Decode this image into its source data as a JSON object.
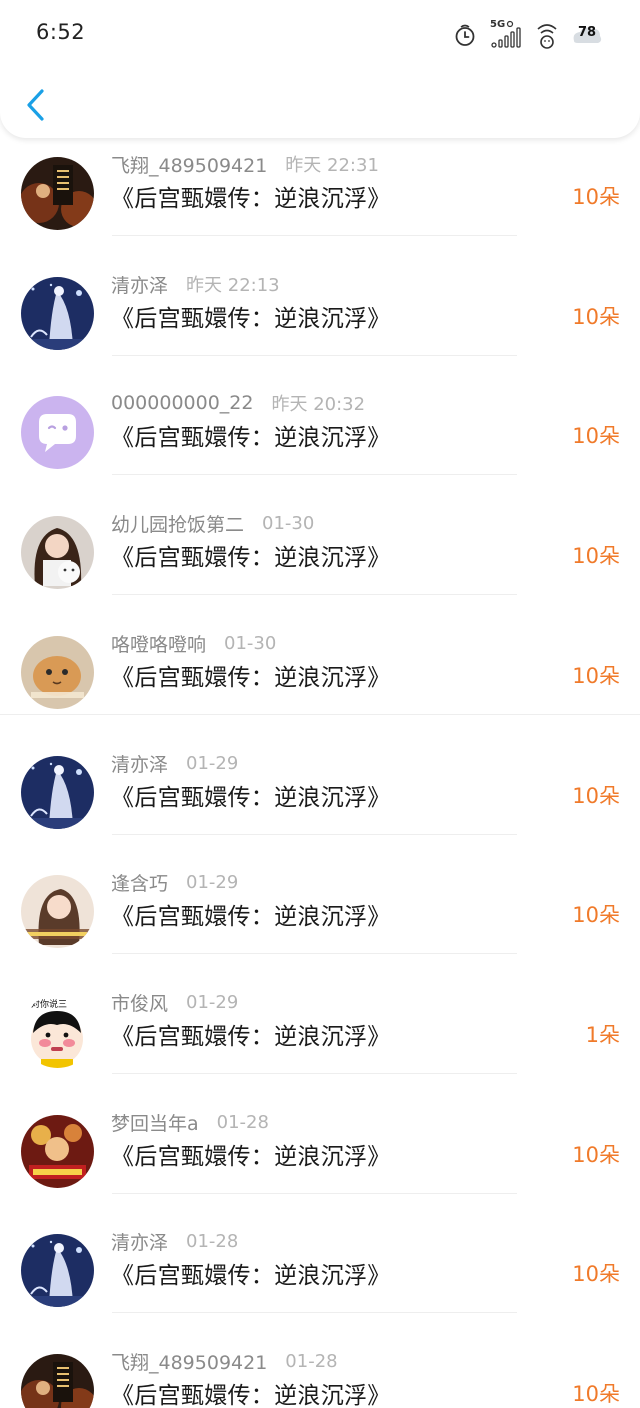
{
  "status_bar": {
    "time": "6:52",
    "network": "5G",
    "battery_level": "78"
  },
  "nav": {
    "back_icon": "chevron-left-icon"
  },
  "colors": {
    "accent": "#1aa0e6",
    "count": "#f07a2a"
  },
  "items": [
    {
      "name": "飞翔_489509421",
      "time": "昨天 22:31",
      "title": "《后宫甄嬛传：逆浪沉浮》",
      "count": "10朵",
      "avatar": "poster-dark"
    },
    {
      "name": "清亦泽",
      "time": "昨天 22:13",
      "title": "《后宫甄嬛传：逆浪沉浮》",
      "count": "10朵",
      "avatar": "night-lady"
    },
    {
      "name": "000000000_22",
      "time": "昨天 20:32",
      "title": "《后宫甄嬛传：逆浪沉浮》",
      "count": "10朵",
      "avatar": "default-chat"
    },
    {
      "name": "幼儿园抢饭第二",
      "time": "01-30",
      "title": "《后宫甄嬛传：逆浪沉浮》",
      "count": "10朵",
      "avatar": "girl-cat"
    },
    {
      "name": "咯噔咯噔响",
      "time": "01-30",
      "title": "《后宫甄嬛传：逆浪沉浮》",
      "count": "10朵",
      "avatar": "cat-meme"
    },
    {
      "name": "清亦泽",
      "time": "01-29",
      "title": "《后宫甄嬛传：逆浪沉浮》",
      "count": "10朵",
      "avatar": "night-lady"
    },
    {
      "name": "逢含巧",
      "time": "01-29",
      "title": "《后宫甄嬛传：逆浪沉浮》",
      "count": "10朵",
      "avatar": "girl-caption"
    },
    {
      "name": "市俊风",
      "time": "01-29",
      "title": "《后宫甄嬛传：逆浪沉浮》",
      "count": "1朵",
      "avatar": "cartoon-face",
      "avatar_caption": "对你说三"
    },
    {
      "name": "梦回当年a",
      "time": "01-28",
      "title": "《后宫甄嬛传：逆浪沉浮》",
      "count": "10朵",
      "avatar": "movie-poster"
    },
    {
      "name": "清亦泽",
      "time": "01-28",
      "title": "《后宫甄嬛传：逆浪沉浮》",
      "count": "10朵",
      "avatar": "night-lady"
    },
    {
      "name": "飞翔_489509421",
      "time": "01-28",
      "title": "《后宫甄嬛传：逆浪沉浮》",
      "count": "10朵",
      "avatar": "poster-dark"
    }
  ]
}
